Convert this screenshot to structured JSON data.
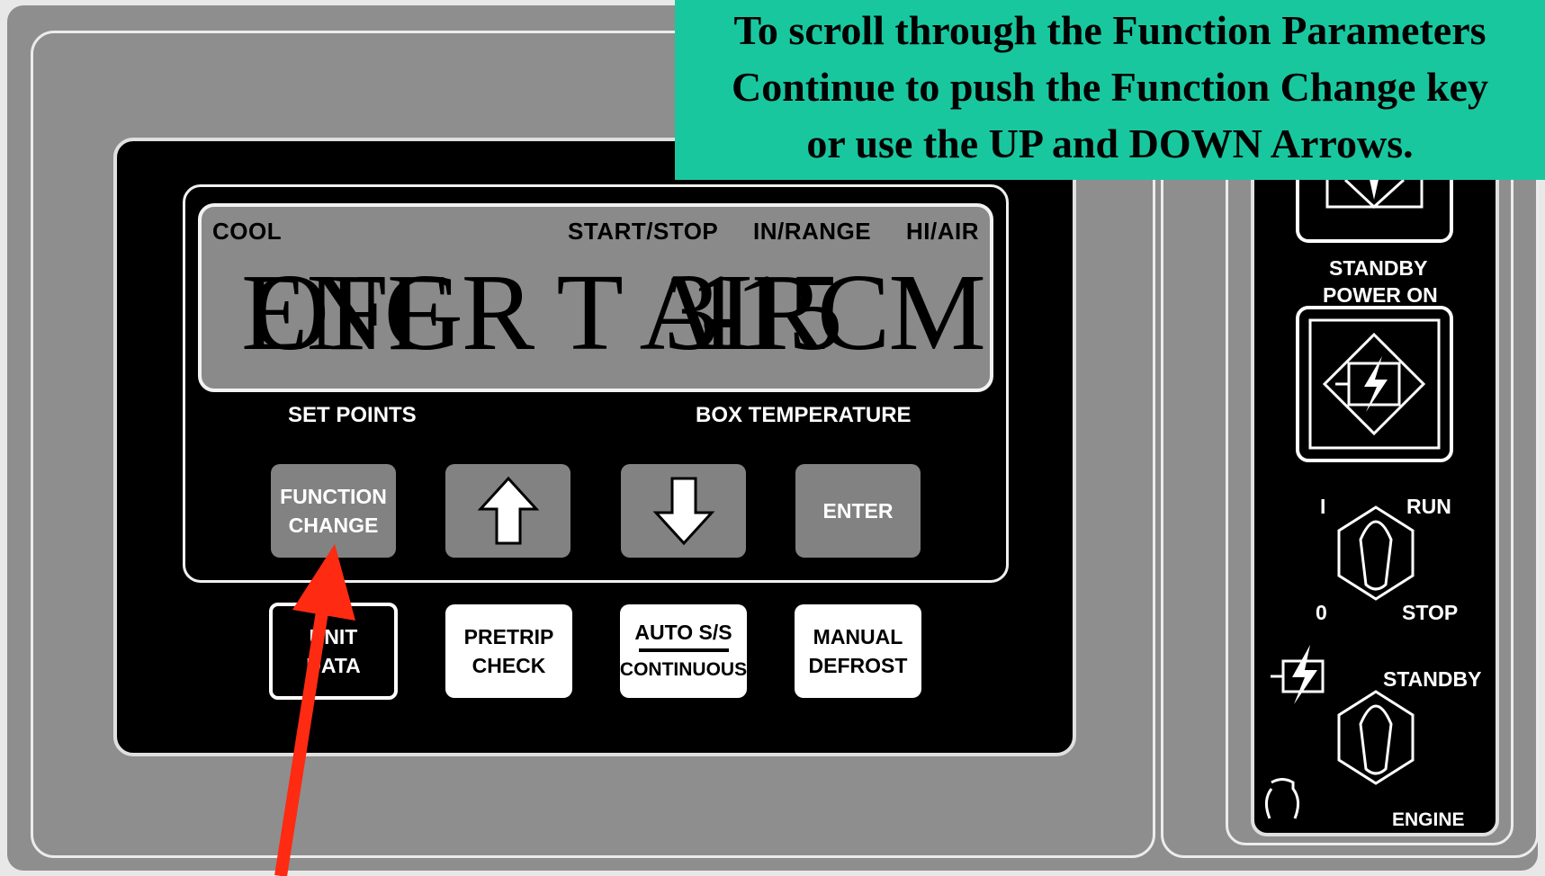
{
  "callout": {
    "line1": "To scroll through the Function Parameters",
    "line2": "Continue to push the Function Change key",
    "line3": "or use the UP and DOWN Arrows."
  },
  "indicators": {
    "cool": "COOL",
    "start_stop": "START/STOP",
    "in_range": "IN/RANGE",
    "hi_air": "HI/AIR"
  },
  "display": {
    "readings": [
      "ENGR T AIR",
      "OFF",
      "3",
      "-15",
      "1",
      "CM"
    ]
  },
  "labels": {
    "set_points": "SET POINTS",
    "box_temperature": "BOX TEMPERATURE"
  },
  "keys": {
    "function_line1": "FUNCTION",
    "function_line2": "CHANGE",
    "enter": "ENTER",
    "unit_line1": "UNIT",
    "unit_line2": "DATA",
    "pretrip_line1": "PRETRIP",
    "pretrip_line2": "CHECK",
    "auto_line1": "AUTO S/S",
    "auto_line2": "CONTINUOUS",
    "defrost_line1": "MANUAL",
    "defrost_line2": "DEFROST"
  },
  "side_panel": {
    "standby_label": "STANDBY",
    "power_on_label": "POWER ON",
    "position_i": "I",
    "run": "RUN",
    "position_0": "0",
    "stop": "STOP",
    "standby": "STANDBY",
    "engine": "ENGINE"
  },
  "colors": {
    "callout_bg": "#19c79f",
    "arrow": "#ff2a12",
    "housing": "#8e8e8e",
    "lcd": "#8a8a8a"
  },
  "icons": [
    "up-arrow-icon",
    "down-arrow-icon",
    "standby-motor-icon",
    "lightning-icon",
    "pointer-arrow-icon"
  ]
}
